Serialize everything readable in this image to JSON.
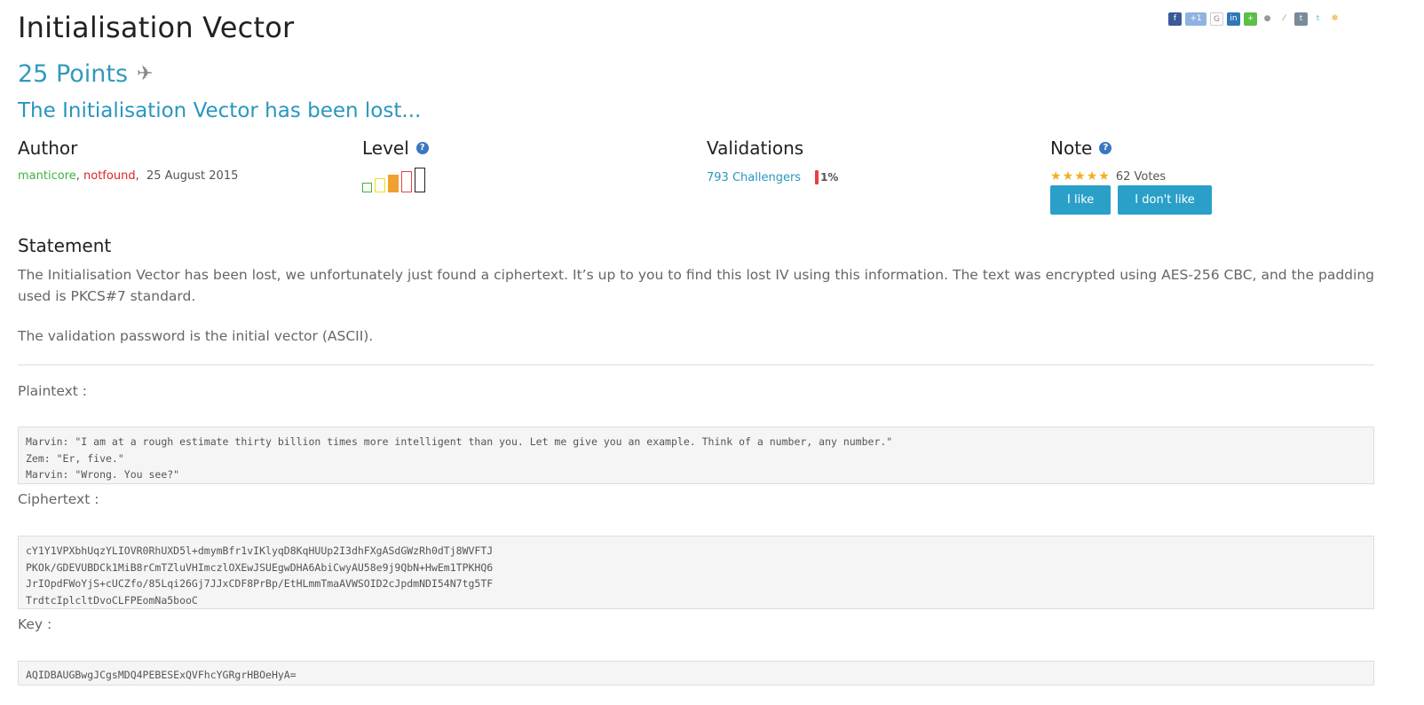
{
  "title": "Initialisation Vector",
  "points": "25 Points",
  "subtitle": "The Initialisation Vector has been lost...",
  "share_icons": [
    "facebook-icon",
    "google-plus-icon",
    "google-icon",
    "linkedin-icon",
    "add-icon",
    "reddit-icon",
    "delicious-icon",
    "tumblr-icon",
    "twitter-icon",
    "more-share-icon"
  ],
  "author": {
    "heading": "Author",
    "names": [
      "manticore",
      "notfound"
    ],
    "date": "25 August 2015"
  },
  "level": {
    "heading": "Level",
    "current": 4,
    "max": 5
  },
  "validations": {
    "heading": "Validations",
    "challengers": "793 Challengers",
    "percent": "1%"
  },
  "note": {
    "heading": "Note",
    "stars": 5,
    "votes": "62 Votes",
    "like_label": "I like",
    "dislike_label": "I don't like"
  },
  "statement": {
    "heading": "Statement",
    "paragraph1": "The Initialisation Vector has been lost, we unfortunately just found a ciphertext. It’s up to you to find this lost IV using this information. The text was encrypted using AES-256 CBC, and the padding used is PKCS#7 standard.",
    "paragraph2": "The validation password is the initial vector (ASCII)."
  },
  "plaintext": {
    "label": "Plaintext :",
    "content": "Marvin: \"I am at a rough estimate thirty billion times more intelligent than you. Let me give you an example. Think of a number, any number.\"\nZem: \"Er, five.\"\nMarvin: \"Wrong. You see?\""
  },
  "ciphertext": {
    "label": "Ciphertext :",
    "content": "cY1Y1VPXbhUqzYLIOVR0RhUXD5l+dmymBfr1vIKlyqD8KqHUUp2I3dhFXgASdGWzRh0dTj8WVFTJ\nPKOk/GDEVUBDCk1MiB8rCmTZluVHImczlOXEwJSUEgwDHA6AbiCwyAU58e9j9QbN+HwEm1TPKHQ6\nJrIOpdFWoYjS+cUCZfo/85Lqi26Gj7JJxCDF8PrBp/EtHLmmTmaAVWSOID2cJpdmNDI54N7tg5TF\nTrdtcIplcltDvoCLFPEomNa5booC"
  },
  "key": {
    "label": "Key :",
    "content": "AQIDBAUGBwgJCgsMDQ4PEBESExQVFhcYGRgrHBOeHyA="
  },
  "colors": {
    "accent": "#2aa0c8",
    "author1": "#3cb53c",
    "author2": "#e02424"
  }
}
